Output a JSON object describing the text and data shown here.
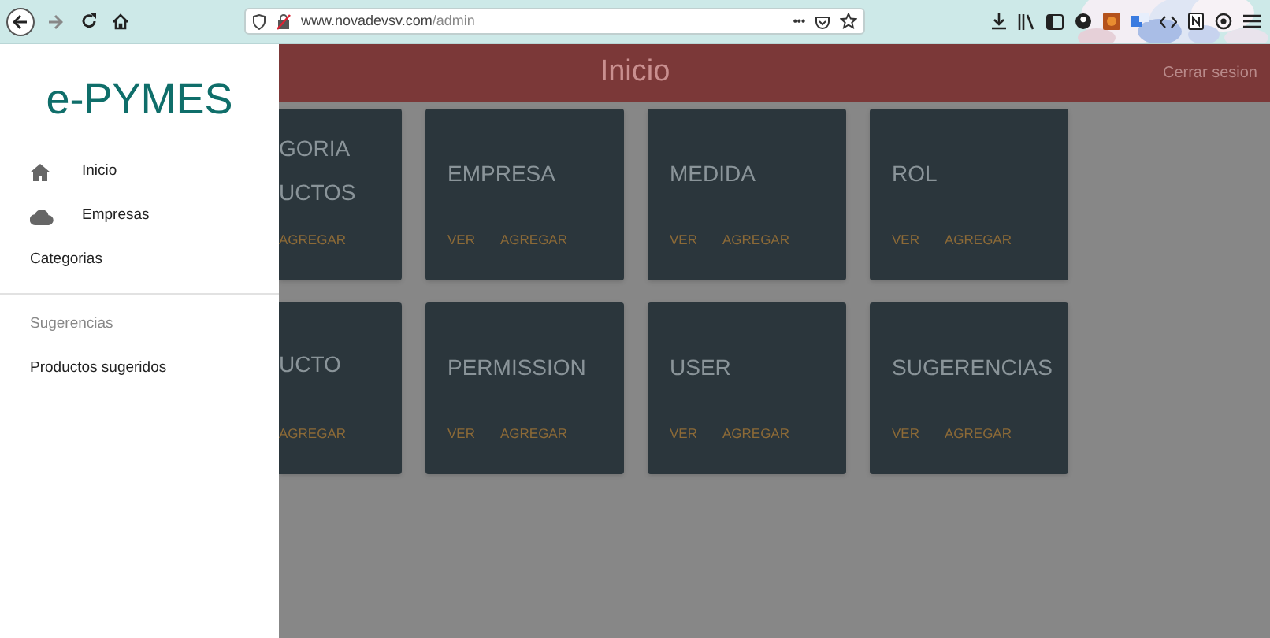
{
  "browser": {
    "url_host": "www.novadevsv.com",
    "url_path": "/admin",
    "menu_dots": "•••"
  },
  "header": {
    "title": "Inicio",
    "logout": "Cerrar sesion"
  },
  "sidebar": {
    "brand": "e-PYMES",
    "items": [
      {
        "kind": "home",
        "label": "Inicio"
      },
      {
        "kind": "cloud",
        "label": "Empresas"
      },
      {
        "kind": "plain",
        "label": "Categorias"
      },
      {
        "kind": "divider"
      },
      {
        "kind": "subheader",
        "label": "Sugerencias"
      },
      {
        "kind": "plain",
        "label": "Productos sugeridos"
      }
    ]
  },
  "cards": [
    {
      "kind": "partial",
      "title_lines": [
        "GORIA",
        "UCTOS"
      ],
      "actions": [
        "AGREGAR"
      ]
    },
    {
      "kind": "full",
      "title_lines": [
        "EMPRESA"
      ],
      "actions": [
        "VER",
        "AGREGAR"
      ]
    },
    {
      "kind": "full",
      "title_lines": [
        "MEDIDA"
      ],
      "actions": [
        "VER",
        "AGREGAR"
      ]
    },
    {
      "kind": "full",
      "title_lines": [
        "ROL"
      ],
      "actions": [
        "VER",
        "AGREGAR"
      ]
    },
    {
      "kind": "partial",
      "title_lines": [
        "UCTO"
      ],
      "actions": [
        "AGREGAR"
      ]
    },
    {
      "kind": "full",
      "title_lines": [
        "PERMISSION"
      ],
      "actions": [
        "VER",
        "AGREGAR"
      ]
    },
    {
      "kind": "full",
      "title_lines": [
        "USER"
      ],
      "actions": [
        "VER",
        "AGREGAR"
      ]
    },
    {
      "kind": "full",
      "title_lines": [
        "SUGERENCIAS"
      ],
      "actions": [
        "VER",
        "AGREGAR"
      ]
    }
  ]
}
